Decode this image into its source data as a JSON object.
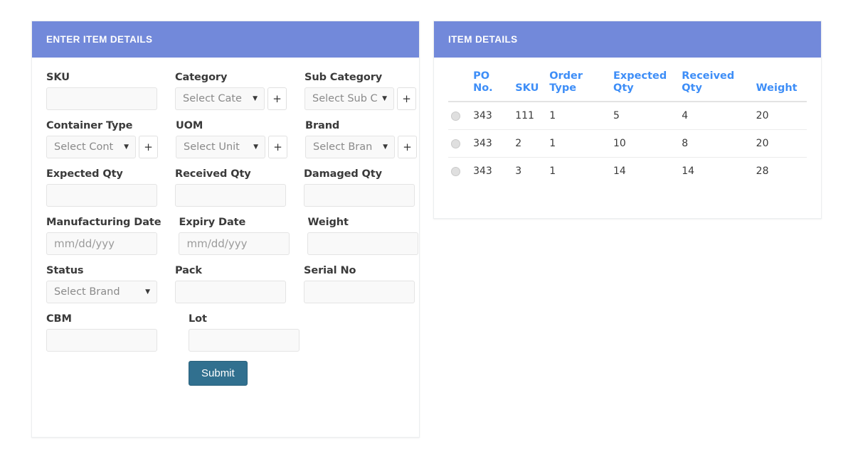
{
  "theme": {
    "header_bg": "#7289da",
    "submit_bg": "#31708f",
    "table_header_color": "#3e8ef7",
    "page_bg": "#ffffff",
    "input_bg": "#f9f9f9"
  },
  "left_panel": {
    "title": "ENTER ITEM DETAILS",
    "rows": [
      [
        {
          "label": "SKU",
          "kind": "text",
          "value": "",
          "placeholder": ""
        },
        {
          "label": "Category",
          "kind": "select-plus",
          "value": "Select Cate",
          "plus": "+"
        },
        {
          "label": "Sub Category",
          "kind": "select-plus",
          "value": "Select Sub C",
          "plus": "+"
        }
      ],
      [
        {
          "label": "Container Type",
          "kind": "select-plus",
          "value": "Select Cont",
          "plus": "+"
        },
        {
          "label": "UOM",
          "kind": "select-plus",
          "value": "Select Unit",
          "plus": "+"
        },
        {
          "label": "Brand",
          "kind": "select-plus",
          "value": "Select Bran",
          "plus": "+"
        }
      ],
      [
        {
          "label": "Expected Qty",
          "kind": "text",
          "value": "",
          "placeholder": ""
        },
        {
          "label": "Received Qty",
          "kind": "text",
          "value": "",
          "placeholder": ""
        },
        {
          "label": "Damaged Qty",
          "kind": "text",
          "value": "",
          "placeholder": ""
        }
      ],
      [
        {
          "label": "Manufacturing Date",
          "kind": "text",
          "value": "",
          "placeholder": "mm/dd/yyy"
        },
        {
          "label": "Expiry Date",
          "kind": "text",
          "value": "",
          "placeholder": "mm/dd/yyy"
        },
        {
          "label": "Weight",
          "kind": "text",
          "value": "",
          "placeholder": ""
        }
      ],
      [
        {
          "label": "Status",
          "kind": "select",
          "value": "Select Brand"
        },
        {
          "label": "Pack",
          "kind": "text",
          "value": "",
          "placeholder": ""
        },
        {
          "label": "Serial No",
          "kind": "text",
          "value": "",
          "placeholder": ""
        }
      ],
      [
        {
          "label": "CBM",
          "kind": "text",
          "value": "",
          "placeholder": ""
        },
        {
          "label": "Lot",
          "kind": "text",
          "value": "",
          "placeholder": ""
        }
      ]
    ],
    "submit_label": "Submit"
  },
  "right_panel": {
    "title": "ITEM DETAILS",
    "table": {
      "columns": [
        "",
        "PO\nNo.",
        "SKU",
        "Order\nType",
        "Expected\nQty",
        "Received\nQty",
        "Weight"
      ],
      "rows": [
        {
          "selected": false,
          "po_no": "343",
          "sku": "111",
          "order_type": "1",
          "expected_qty": "5",
          "received_qty": "4",
          "weight": "20"
        },
        {
          "selected": false,
          "po_no": "343",
          "sku": "2",
          "order_type": "1",
          "expected_qty": "10",
          "received_qty": "8",
          "weight": "20"
        },
        {
          "selected": false,
          "po_no": "343",
          "sku": "3",
          "order_type": "1",
          "expected_qty": "14",
          "received_qty": "14",
          "weight": "28"
        }
      ]
    }
  }
}
